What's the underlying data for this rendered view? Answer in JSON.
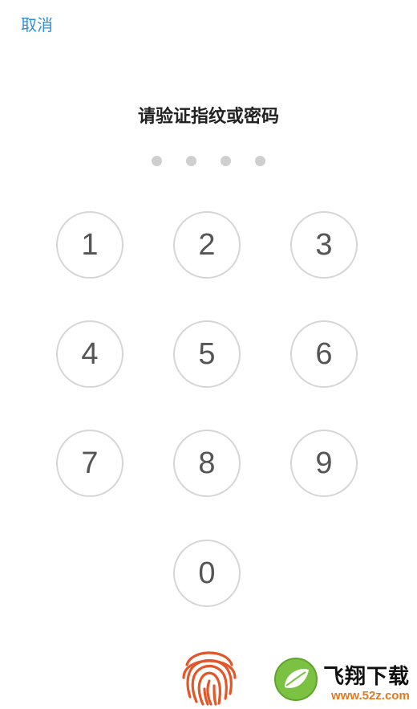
{
  "header": {
    "cancel_label": "取消"
  },
  "prompt": {
    "title": "请验证指纹或密码"
  },
  "passcode": {
    "length": 4,
    "entered": 0
  },
  "keypad": {
    "keys": [
      "1",
      "2",
      "3",
      "4",
      "5",
      "6",
      "7",
      "8",
      "9",
      "0"
    ]
  },
  "fingerprint": {
    "icon": "fingerprint-icon",
    "color": "#e2572a"
  },
  "watermark": {
    "title": "飞翔下载",
    "url": "www.52z.com",
    "icon": "leaf-logo"
  },
  "colors": {
    "accent": "#2f8fd4",
    "dot": "#cfcfcf",
    "key_border": "#d6d6d6",
    "key_text": "#555555"
  }
}
